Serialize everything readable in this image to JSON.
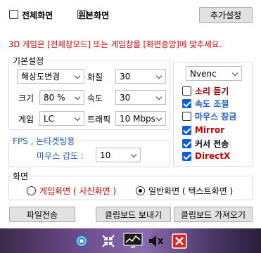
{
  "top": {
    "fullscreen_label": "전체화면",
    "fullscreen_checked": false,
    "original_label": "원본화면",
    "original_checked": false,
    "add_settings_button": "추가설정"
  },
  "notice": "3D 게임은 [전체창모드] 또는 게임창을 [화면중앙]에 맞추세요.",
  "basic": {
    "title": "기본설정",
    "resolution_select": "해상도변경",
    "quality_label": "화질",
    "quality_value": "30",
    "size_label": "크기",
    "size_value": "80 %",
    "speed_label": "속도",
    "speed_value": "30",
    "game_label": "게임",
    "game_value": "LC",
    "traffic_label": "트래픽",
    "traffic_value": "10 Mbps"
  },
  "encoder": {
    "value": "Nvenc",
    "options": [
      {
        "label": "소리 듣기",
        "checked": false,
        "color": "#8b0000"
      },
      {
        "label": "속도 조절",
        "checked": true,
        "color": "#1f5fbf"
      },
      {
        "label": "마우스 잠금",
        "checked": false,
        "color": "#1f5fbf"
      },
      {
        "label": "Mirror",
        "checked": true,
        "color": "#c00000"
      },
      {
        "label": "커서 전송",
        "checked": true,
        "color": "#000000"
      },
      {
        "label": "DirectX",
        "checked": true,
        "color": "#c00000"
      }
    ]
  },
  "fps": {
    "title": "FPS , 논타겟팅용",
    "mouse_label": "마우스 감도 :",
    "mouse_value": "10"
  },
  "screen": {
    "title": "화면",
    "game_screen_label": "게임화면 ( 사진화면 )",
    "game_screen_selected": false,
    "normal_screen_label": "일반화면 ( 텍스트화면 )",
    "normal_screen_selected": true
  },
  "buttons": {
    "file_transfer": "파일전송",
    "clipboard_send": "클립보드 보내기",
    "clipboard_get": "클립보드 가져오기"
  },
  "taskbar_icons": [
    "settings-gear-icon",
    "collapse-arrows-icon",
    "monitor-chart-icon",
    "mute-speaker-icon",
    "close-x-icon"
  ]
}
